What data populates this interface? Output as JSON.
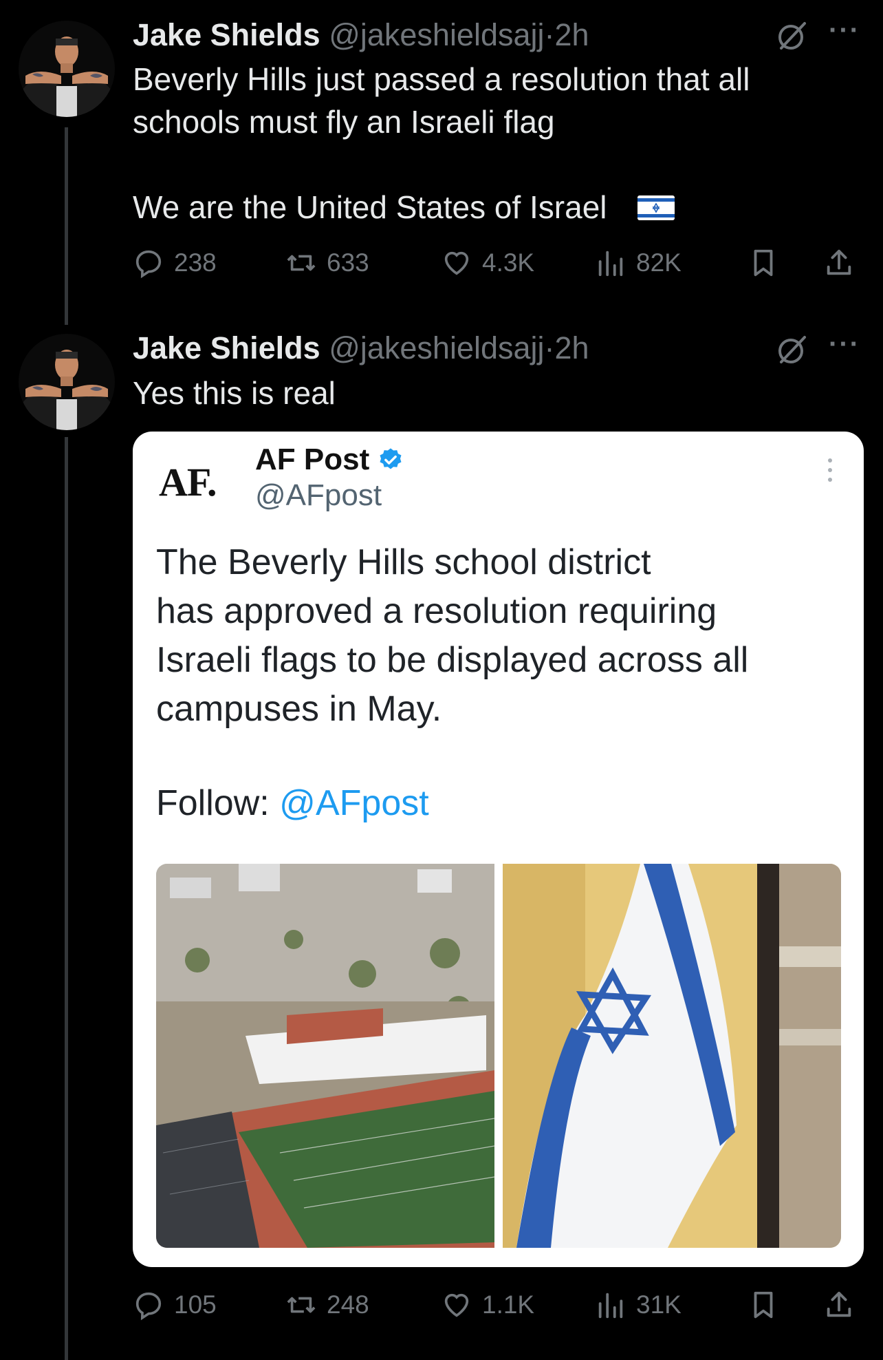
{
  "tweets": [
    {
      "name": "Jake Shields",
      "handle": "@jakeshieldsajj",
      "sep": "·",
      "time": "2h",
      "more": "···",
      "text_line1": "Beverly Hills just passed a resolution that all",
      "text_line2": "schools must fly an Israeli flag",
      "text_line3": "We are the United States of Israel",
      "flag_emoji": "israel-flag-icon",
      "replies": "238",
      "retweets": "633",
      "likes": "4.3K",
      "views": "82K"
    },
    {
      "name": "Jake Shields",
      "handle": "@jakeshieldsajj",
      "sep": "·",
      "time": "2h",
      "more": "···",
      "text_line1": "Yes this is real",
      "replies": "105",
      "retweets": "248",
      "likes": "1.1K",
      "views": "31K"
    }
  ],
  "embedded_post": {
    "logo": "AF.",
    "name": "AF Post",
    "handle": "@AFpost",
    "verified": true,
    "text": "The Beverly Hills school district\nhas approved a resolution requiring\nIsraeli flags to be displayed across all\ncampuses in May.",
    "follow_label": "Follow:",
    "follow_handle": "@AFpost",
    "images": [
      "aerial-school-campus-photo",
      "israeli-flag-photo"
    ]
  },
  "colors": {
    "background": "#000000",
    "muted": "#71767b",
    "link": "#1d9bf0",
    "verified": "#1d9bf0"
  }
}
